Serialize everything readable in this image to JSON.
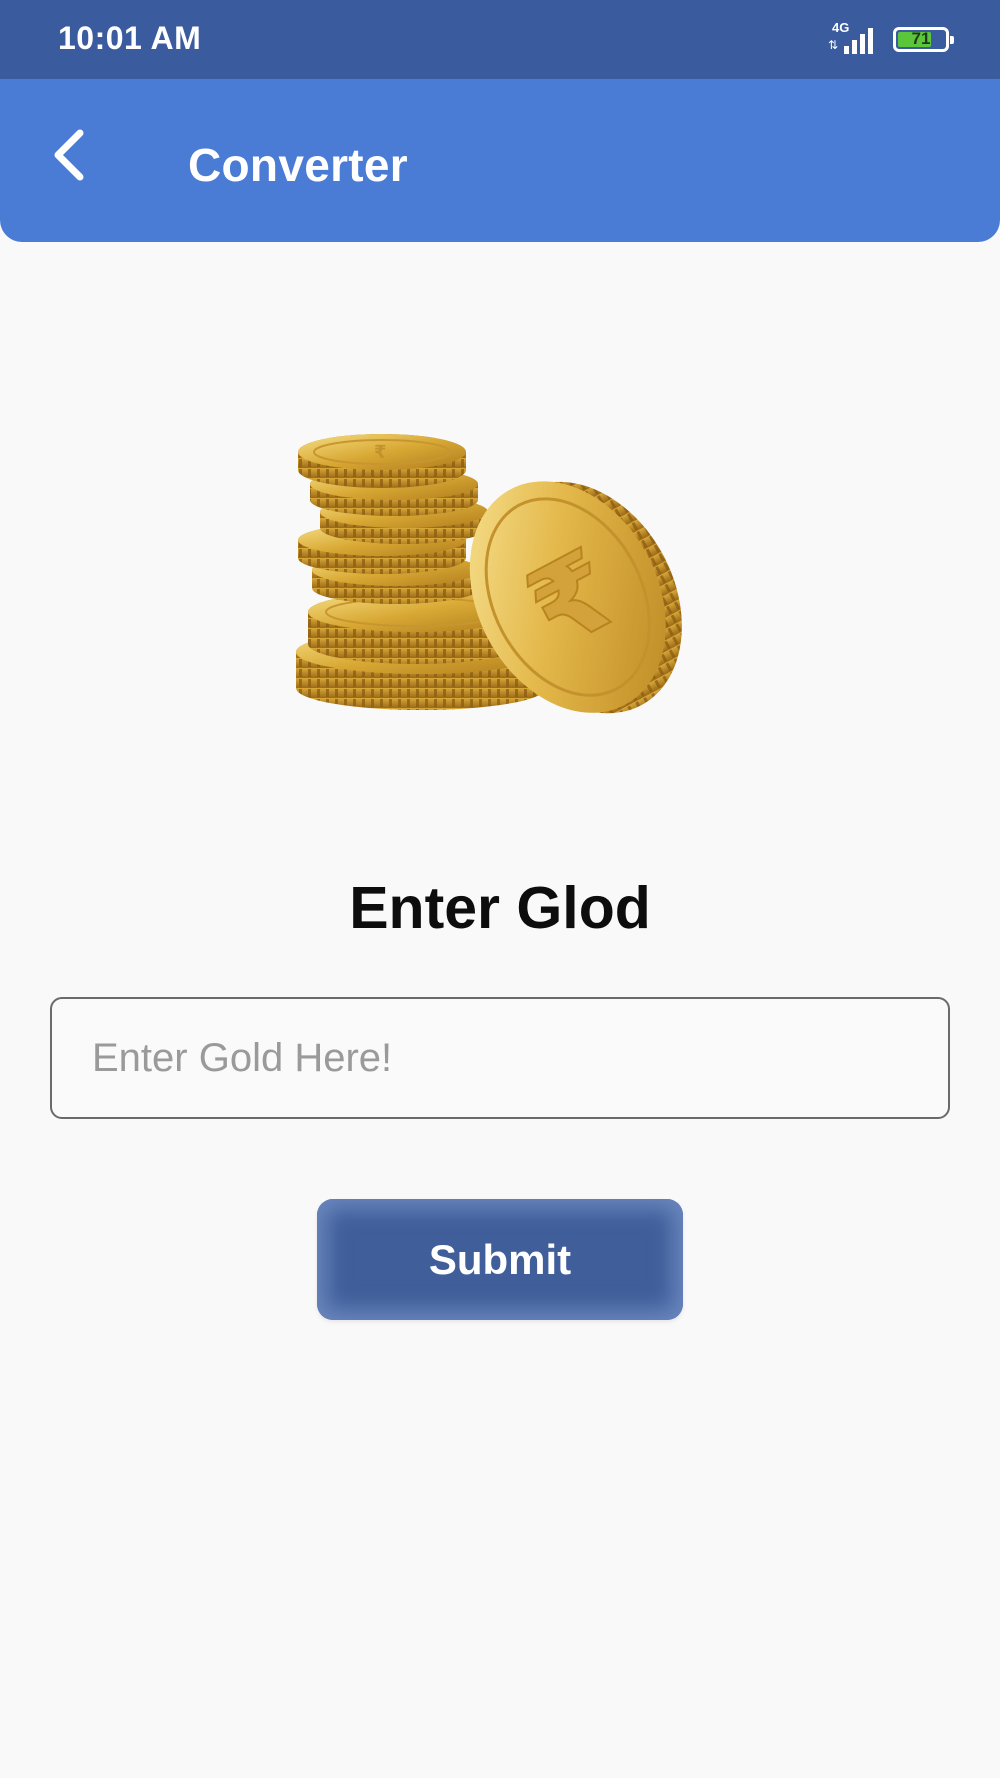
{
  "status_bar": {
    "time": "10:01 AM",
    "network": "4G",
    "network_arrows": "⇅",
    "battery_level": "71",
    "battery_fraction": 0.71,
    "signal_icon": "cellular-signal-icon",
    "battery_icon": "battery-icon"
  },
  "app_bar": {
    "title": "Converter",
    "back_icon": "chevron-left-icon",
    "color": "#4a7bd5"
  },
  "hero": {
    "icon": "gold-coins-icon"
  },
  "form": {
    "heading": "Enter Glod",
    "input_placeholder": "Enter Gold Here!",
    "input_value": "",
    "submit_label": "Submit",
    "submit_color": "#3f5e9a"
  }
}
